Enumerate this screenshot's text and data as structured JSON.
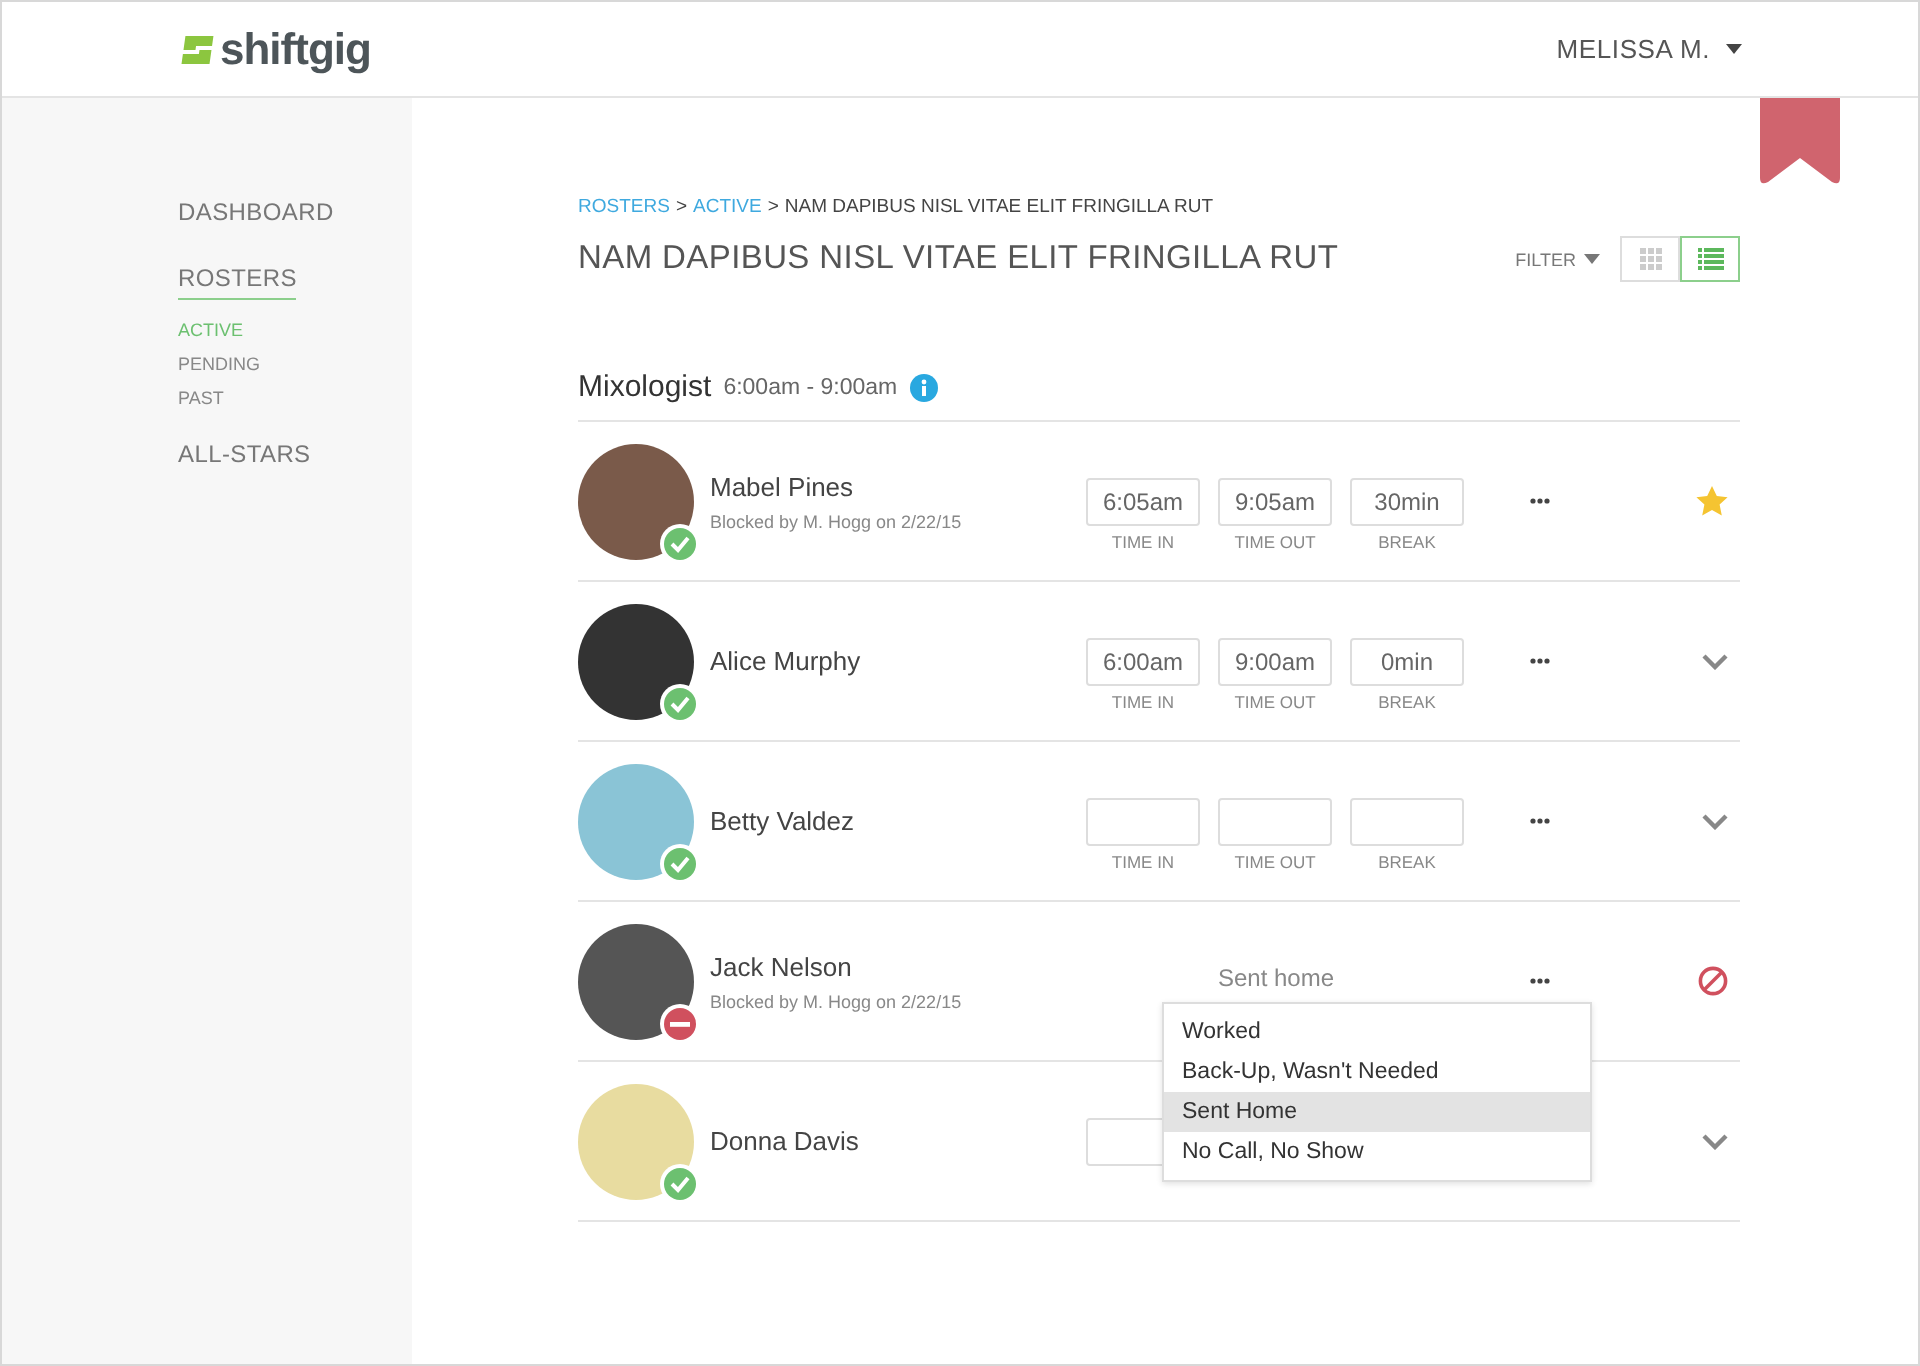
{
  "header": {
    "logo": "shiftgig",
    "user": "MELISSA M."
  },
  "sidebar": {
    "items": [
      {
        "label": "DASHBOARD",
        "selected": false
      },
      {
        "label": "ROSTERS",
        "selected": true,
        "children": [
          {
            "label": "ACTIVE",
            "selected": true
          },
          {
            "label": "PENDING",
            "selected": false
          },
          {
            "label": "PAST",
            "selected": false
          }
        ]
      },
      {
        "label": "ALL-STARS",
        "selected": false
      }
    ]
  },
  "breadcrumb": [
    {
      "label": "ROSTERS",
      "link": true
    },
    {
      "label": ">",
      "link": false
    },
    {
      "label": "ACTIVE",
      "link": true
    },
    {
      "label": ">",
      "link": false
    },
    {
      "label": "NAM DAPIBUS NISL VITAE ELIT FRINGILLA RUT",
      "link": false
    }
  ],
  "page_title": "NAM DAPIBUS NISL VITAE ELIT FRINGILLA RUT",
  "toolbar": {
    "filter": "FILTER",
    "views": [
      {
        "kind": "grid",
        "selected": false
      },
      {
        "kind": "list",
        "selected": true
      }
    ]
  },
  "section": {
    "title": "Mixologist",
    "time": "6:00am - 9:00am"
  },
  "rows": [
    {
      "name": "Mabel Pines",
      "note": "Blocked by M. Hogg on 2/22/15",
      "blocked": false,
      "starred": true,
      "more_button": true,
      "fields": [
        {
          "value": "6:05am",
          "label": "TIME IN"
        },
        {
          "value": "9:05am",
          "label": "TIME OUT"
        },
        {
          "value": "30min",
          "label": "BREAK"
        }
      ]
    },
    {
      "name": "Alice Murphy",
      "blocked": false,
      "starred": false,
      "more_button": true,
      "fields": [
        {
          "value": "6:00am",
          "label": "TIME IN"
        },
        {
          "value": "9:00am",
          "label": "TIME OUT"
        },
        {
          "value": "0min",
          "label": "BREAK"
        }
      ]
    },
    {
      "name": "Betty Valdez",
      "blocked": false,
      "starred": false,
      "more_button": true,
      "fields": [
        {
          "label": "TIME IN"
        },
        {
          "label": "TIME OUT"
        },
        {
          "label": "BREAK"
        }
      ]
    },
    {
      "name": "Jack Nelson",
      "note": "Blocked by M. Hogg on 2/22/15",
      "blocked": true,
      "more_button": true,
      "result": "Sent home",
      "menu": [
        {
          "label": "Worked",
          "selected": false
        },
        {
          "label": "Back-Up, Wasn't Needed",
          "selected": false
        },
        {
          "label": "Sent Home",
          "selected": true
        },
        {
          "label": "No Call, No Show",
          "selected": false
        }
      ]
    },
    {
      "name": "Donna Davis",
      "blocked": false,
      "starred": false,
      "fields": [
        {
          "kind": "time"
        }
      ]
    }
  ]
}
